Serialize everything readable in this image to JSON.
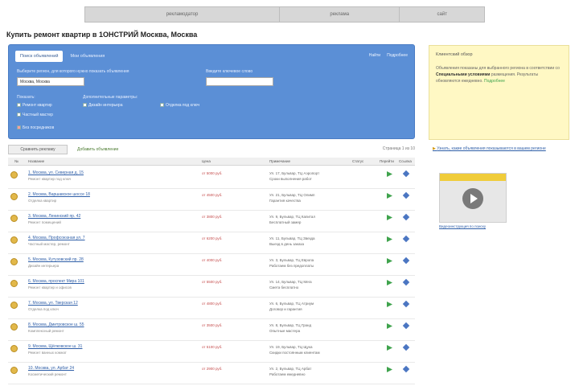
{
  "topbar": {
    "tabs": [
      "рекламодатор",
      "реклама",
      "сайт"
    ]
  },
  "page_title": "Купить ремонт квартир в 1ОНСТРИЙ Москва, Москва",
  "filter_panel": {
    "active_tab": "Поиск объявлений",
    "inactive_tab": "Мои объявления",
    "links": [
      "Найти",
      "Подробнее"
    ],
    "region_label": "Выберите регион, для которого нужно показать объявления",
    "region_value": "Москва, Москва",
    "keyword_label": "Введите ключевое слово",
    "checks_group1_label": "Показать:",
    "checks_group2_label": "Дополнительные параметры:",
    "checks": [
      "Ремонт квартир",
      "Дизайн интерьера",
      "Отделка под ключ",
      "Частный мастер",
      "Без посредников"
    ]
  },
  "notice": {
    "title": "Клиентский обзор",
    "text_before": "Объявления показаны для выбранного региона в соответствии со ",
    "text_bold": "Специальными условиями",
    "text_after": " размещения. Результаты обновляются ежедневно.",
    "tail": "Подробнее"
  },
  "toolbar": {
    "button_label": "Сравнить рекламу",
    "add_label": "Добавить объявление",
    "pagination": "Страница 1 из 10"
  },
  "table": {
    "headers": [
      "№",
      "Название",
      "Цена",
      "Примечание",
      "Статус",
      "Перейти",
      "Ссылка"
    ],
    "rows": [
      {
        "title": "1. Москва, ул. Северная д. 15",
        "subtitle": "Ремонт квартир под ключ",
        "price": "от 5000 руб.",
        "desc_line1": "Ул. 17, Бульвар, ТЦ Аэропорт",
        "desc_line2": "Сроки выполнения работ"
      },
      {
        "title": "2. Москва, Варшавское шоссе 18",
        "subtitle": "Отделка квартир",
        "price": "от 4500 руб.",
        "desc_line1": "Ул. 21, Бульвар, ТЦ Олимп",
        "desc_line2": "Гарантия качества"
      },
      {
        "title": "3. Москва, Ленинский пр. 42",
        "subtitle": "Ремонт помещений",
        "price": "от 3800 руб.",
        "desc_line1": "Ул. 9, Бульвар, ТЦ Капитал",
        "desc_line2": "Бесплатный замер"
      },
      {
        "title": "4. Москва, Профсоюзная ул. 7",
        "subtitle": "Частный мастер, ремонт",
        "price": "от 6200 руб.",
        "desc_line1": "Ул. 11, Бульвар, ТЦ Звезда",
        "desc_line2": "Выезд в день заказа"
      },
      {
        "title": "5. Москва, Кутузовский пр. 28",
        "subtitle": "Дизайн интерьера",
        "price": "от 4000 руб.",
        "desc_line1": "Ул. 3, Бульвар, ТЦ Европа",
        "desc_line2": "Работаем без предоплаты"
      },
      {
        "title": "6. Москва, проспект Мира 101",
        "subtitle": "Ремонт квартир и офисов",
        "price": "от 5500 руб.",
        "desc_line1": "Ул. 14, Бульвар, ТЦ Мега",
        "desc_line2": "Смета бесплатно"
      },
      {
        "title": "7. Москва, ул. Тверская 12",
        "subtitle": "Отделка под ключ",
        "price": "от 4800 руб.",
        "desc_line1": "Ул. 6, Бульвар, ТЦ Атриум",
        "desc_line2": "Договор и гарантия"
      },
      {
        "title": "8. Москва, Дмитровское ш. 55",
        "subtitle": "Комплексный ремонт",
        "price": "от 3500 руб.",
        "desc_line1": "Ул. 8, Бульвар, ТЦ Гранд",
        "desc_line2": "Опытные мастера"
      },
      {
        "title": "9. Москва, Щёлковское ш. 31",
        "subtitle": "Ремонт ванных комнат",
        "price": "от 5100 руб.",
        "desc_line1": "Ул. 19, Бульвар, ТЦ Щука",
        "desc_line2": "Скидки постоянным клиентам"
      },
      {
        "title": "10. Москва, ул. Арбат 24",
        "subtitle": "Косметический ремонт",
        "price": "от 2900 руб.",
        "desc_line1": "Ул. 2, Бульвар, ТЦ Арбат",
        "desc_line2": "Работаем ежедневно"
      }
    ]
  },
  "sidebar": {
    "link_text": "Узнать, какие объявления показываются в вашем регионе",
    "video_caption": "Видеоинструкция по поиску"
  },
  "colors": {
    "panel_blue": "#5b8fd6",
    "notice_yellow": "#fff8c4",
    "link_blue": "#2f5fa8",
    "price_red": "#c54c4c",
    "go_green": "#3fa34d"
  }
}
